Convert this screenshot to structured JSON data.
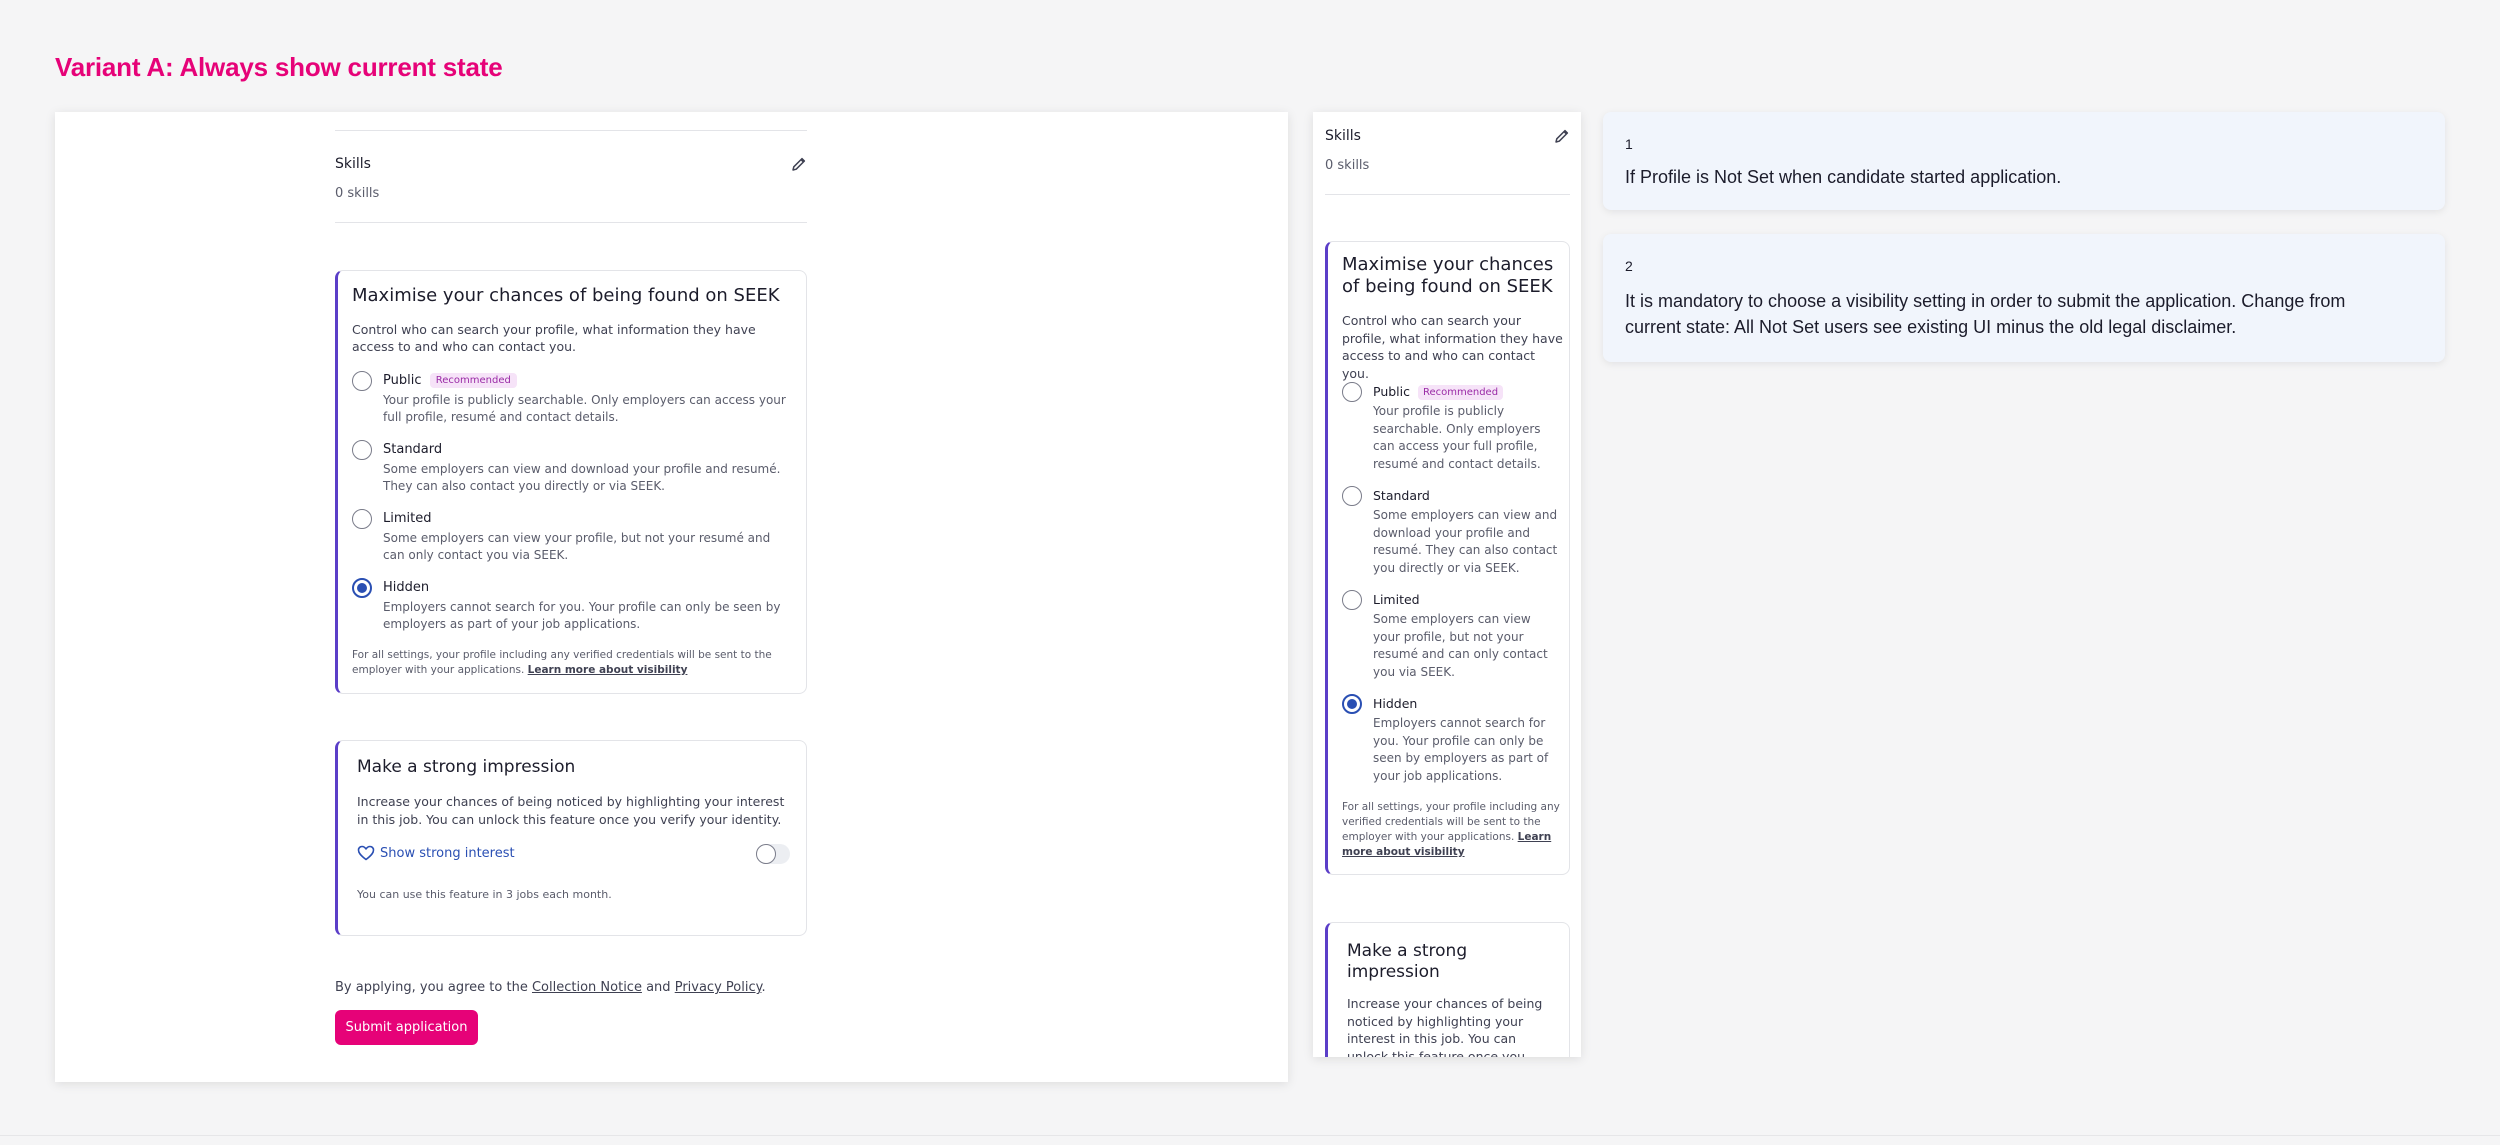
{
  "frame_title": "Variant A: Always show current state",
  "skills": {
    "label": "Skills",
    "count": "0 skills"
  },
  "visibility": {
    "title": "Maximise your chances of being found on SEEK",
    "description": "Control who can search your profile, what information they have access to and who can contact you.",
    "recommended_badge": "Recommended",
    "options": [
      {
        "title": "Public",
        "body": "Your profile is publicly searchable. Only employers can access your full profile, resumé and contact details."
      },
      {
        "title": "Standard",
        "body": "Some employers can view and download your profile and resumé. They can also contact you directly or via SEEK."
      },
      {
        "title": "Limited",
        "body": "Some employers can view your profile, but not your resumé and can only contact you via SEEK."
      },
      {
        "title": "Hidden",
        "body": "Employers cannot search for you. Your profile can only be seen by employers as part of your job applications."
      }
    ],
    "selected": "Hidden",
    "fine_print": "For all settings, your profile including any verified credentials will be sent to the employer with your applications.",
    "learn_more": "Learn more about visibility"
  },
  "impression": {
    "title": "Make a strong impression",
    "description": "Increase your chances of being noticed by highlighting your interest in this job. You can unlock this feature once you verify your identity.",
    "show_interest": "Show strong interest",
    "usage_note": "You can use this feature in 3 jobs each month.",
    "mobile_description_visible": "Increase your chances of being noticed by highlighting your interest in this job. You can unlock this feature once you verify your"
  },
  "footer": {
    "agree_prefix": "By applying, you agree to the",
    "collection_notice": "Collection Notice",
    "and": "and",
    "privacy_policy": "Privacy Policy",
    "period": ".",
    "submit": "Submit application"
  },
  "notes": [
    {
      "number": "1",
      "text": "If Profile is Not Set when candidate started application."
    },
    {
      "number": "2",
      "text": "It is mandatory to choose a visibility setting in order to submit the application. Change from current state: All Not Set users see existing UI minus the old legal disclaimer."
    }
  ],
  "colors": {
    "accent": "#e60278",
    "card_border": "#5b3ec8",
    "radio_selected": "#2a4fb3",
    "note_bg": "#f1f5fc"
  },
  "icons": {
    "edit": "pencil-icon",
    "interest": "heart-icon"
  }
}
